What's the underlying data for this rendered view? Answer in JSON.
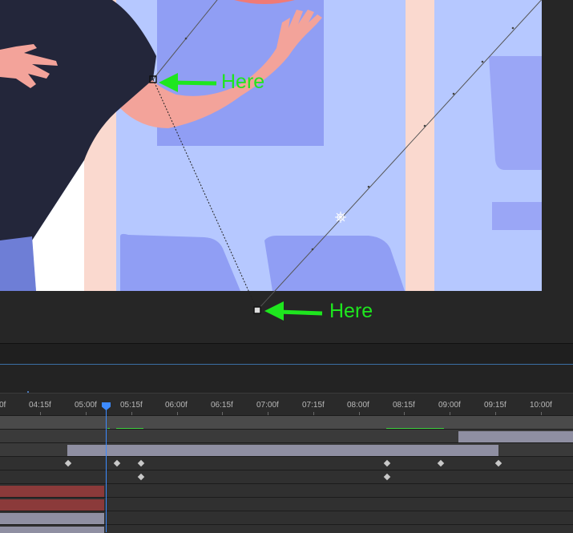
{
  "annotations": {
    "top_label": "Here",
    "bottom_label": "Here",
    "arrow_color": "#1ee61e"
  },
  "timeline": {
    "ruler_ticks": [
      "0f",
      "04:15f",
      "05:00f",
      "05:15f",
      "06:00f",
      "06:15f",
      "07:00f",
      "07:15f",
      "08:00f",
      "08:15f",
      "09:00f",
      "09:15f",
      "10:00f"
    ],
    "playhead_color": "#3d8bff"
  },
  "colors": {
    "sky": "#b6c8ff",
    "window": "#909ef4",
    "pillar": "#fad9cf",
    "shirt": "#23263a",
    "skin": "#f3a39a",
    "clip_red": "#8b3a3a",
    "clip_gray": "#8f8fa2"
  }
}
